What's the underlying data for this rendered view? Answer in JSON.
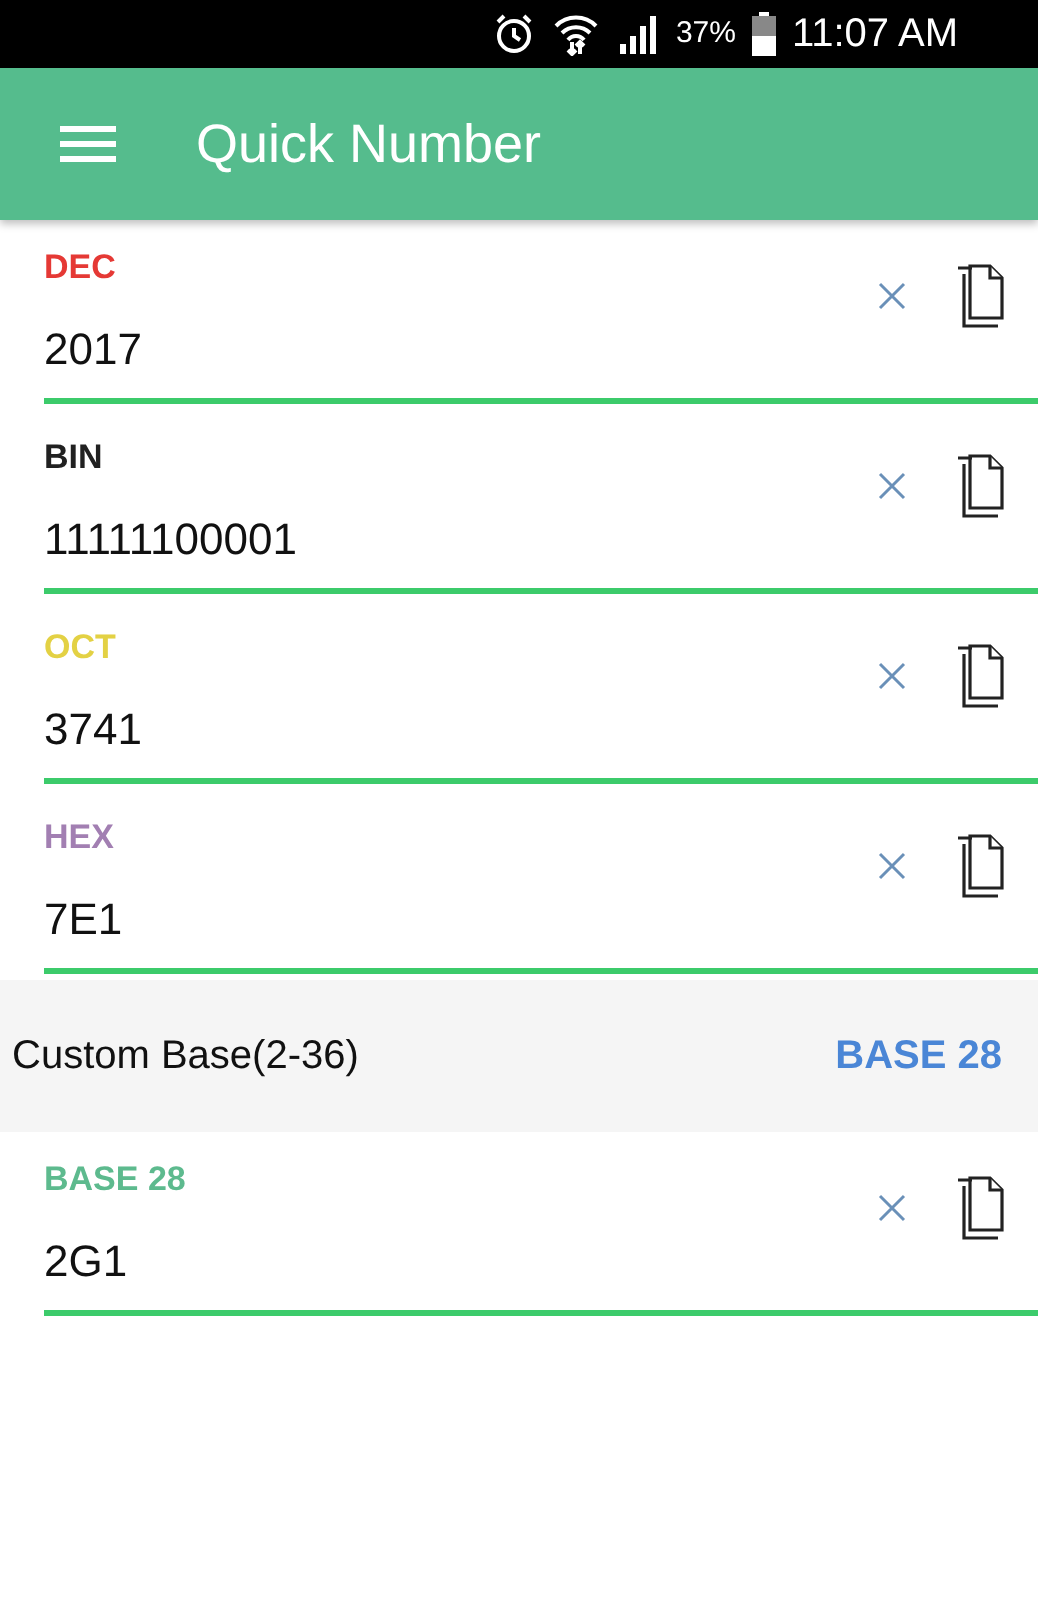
{
  "status_bar": {
    "battery_percent": "37%",
    "time": "11:07 AM"
  },
  "app_bar": {
    "title": "Quick Number"
  },
  "fields": [
    {
      "label": "DEC",
      "color": "#e53935",
      "value": "2017"
    },
    {
      "label": "BIN",
      "color": "#212121",
      "value": "11111100001"
    },
    {
      "label": "OCT",
      "color": "#e3d144",
      "value": "3741"
    },
    {
      "label": "HEX",
      "color": "#a27fb2",
      "value": "7E1"
    }
  ],
  "custom_base": {
    "label": "Custom Base(2-36)",
    "button": "BASE 28"
  },
  "custom_fields": [
    {
      "label": "BASE 28",
      "color": "#5dba8e",
      "value": "2G1"
    }
  ]
}
